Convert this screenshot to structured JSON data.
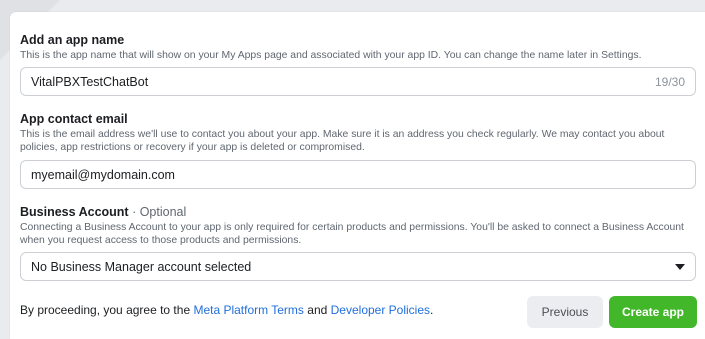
{
  "app_name": {
    "label": "Add an app name",
    "help": "This is the app name that will show on your My Apps page and associated with your app ID. You can change the name later in Settings.",
    "value": "VitalPBXTestChatBot",
    "counter": "19/30"
  },
  "contact_email": {
    "label": "App contact email",
    "help": "This is the email address we'll use to contact you about your app. Make sure it is an address you check regularly. We may contact you about policies, app restrictions or recovery if your app is deleted or compromised.",
    "value": "myemail@mydomain.com"
  },
  "business_account": {
    "label": "Business Account",
    "optional": " · Optional",
    "help": "Connecting a Business Account to your app is only required for certain products and permissions. You'll be asked to connect a Business Account when you request access to those products and permissions.",
    "selected": "No Business Manager account selected",
    "icon": "chevron-down-icon"
  },
  "footer": {
    "prefix": "By proceeding, you agree to the ",
    "terms_link": "Meta Platform Terms",
    "and": " and ",
    "policies_link": "Developer Policies",
    "suffix": "."
  },
  "buttons": {
    "previous": "Previous",
    "create": "Create app"
  },
  "colors": {
    "accent_green": "#42b72a",
    "link_blue": "#216fdb"
  }
}
